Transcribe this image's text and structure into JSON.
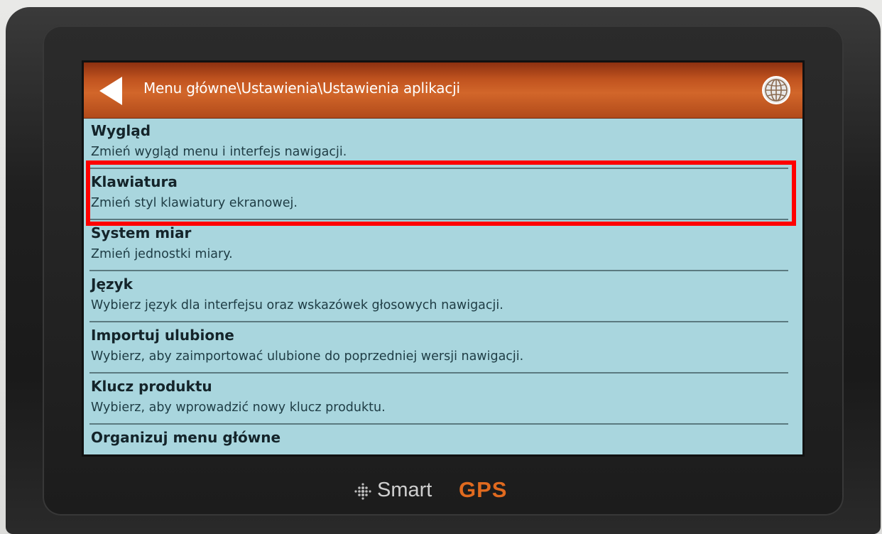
{
  "header": {
    "breadcrumb": "Menu główne\\Ustawienia\\Ustawienia aplikacji",
    "back_icon": "back-arrow-icon",
    "globe_icon": "globe-icon"
  },
  "menu": {
    "items": [
      {
        "title": "Wygląd",
        "description": "Zmień wygląd menu i interfejs nawigacji."
      },
      {
        "title": "Klawiatura",
        "description": "Zmień styl klawiatury ekranowej."
      },
      {
        "title": "System miar",
        "description": "Zmień jednostki miary."
      },
      {
        "title": "Język",
        "description": "Wybierz język dla interfejsu oraz wskazówek głosowych nawigacji."
      },
      {
        "title": "Importuj ulubione",
        "description": "Wybierz, aby zaimportować ulubione do poprzedniej wersji nawigacji."
      },
      {
        "title": "Klucz produktu",
        "description": "Wybierz, aby wprowadzić nowy klucz produktu."
      },
      {
        "title": "Organizuj menu główne",
        "description": ""
      }
    ]
  },
  "brand": {
    "smart": "Smart",
    "gps": "GPS"
  },
  "colors": {
    "header": "#c0531f",
    "list_background": "#a9d6de",
    "highlight": "#ff0000",
    "gps_accent": "#e06a1f"
  }
}
